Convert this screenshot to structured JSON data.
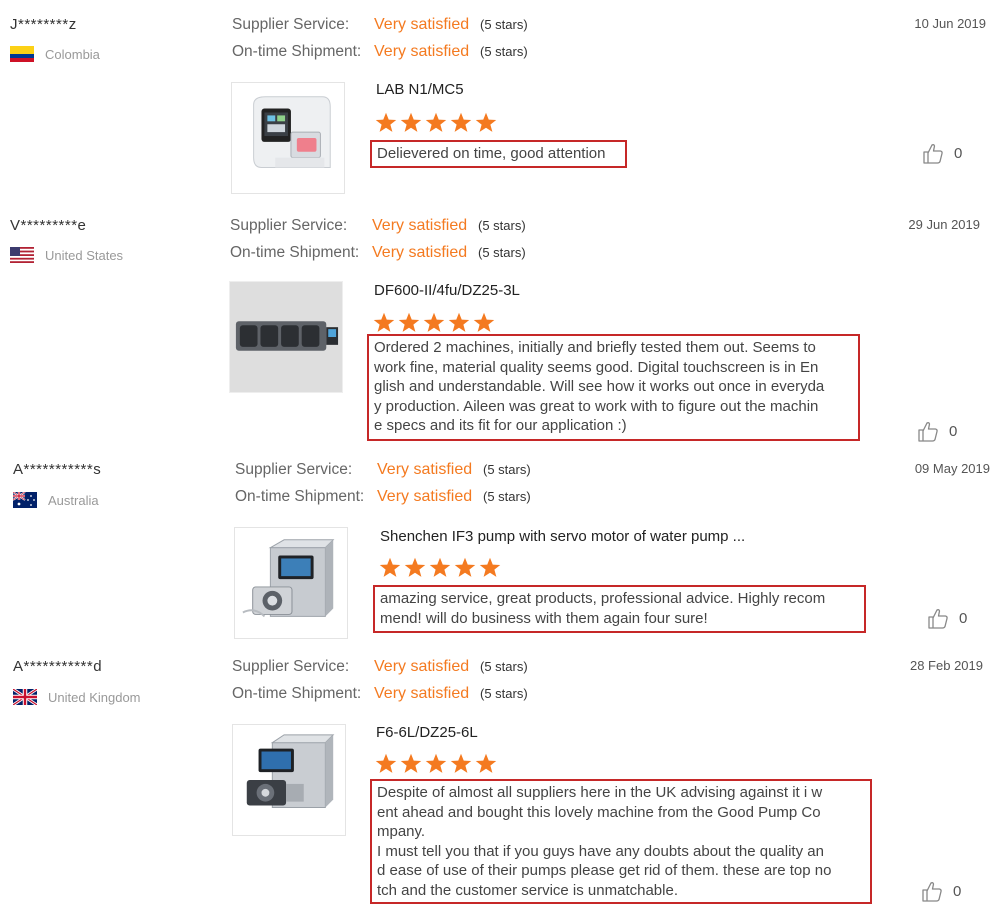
{
  "labels": {
    "supplier_service": "Supplier Service:",
    "ontime_shipment": "On-time Shipment:"
  },
  "colors": {
    "accent_orange": "#f47a20",
    "highlight_red": "#c62828",
    "star_orange": "#f47a20"
  },
  "reviews": [
    {
      "buyer": "J********z",
      "country": "Colombia",
      "flag": "colombia-flag",
      "date": "10 Jun 2019",
      "supplier_service": "Very satisfied",
      "supplier_service_stars": "(5 stars)",
      "shipment": "Very satisfied",
      "shipment_stars": "(5 stars)",
      "product": "LAB N1/MC5",
      "rating": 5,
      "comment": [
        "Delievered on time, good attention"
      ],
      "likes": "0"
    },
    {
      "buyer": "V*********e",
      "country": "United States",
      "flag": "usa-flag",
      "date": "29 Jun 2019",
      "supplier_service": "Very satisfied",
      "supplier_service_stars": "(5 stars)",
      "shipment": "Very satisfied",
      "shipment_stars": "(5 stars)",
      "product": "DF600-II/4fu/DZ25-3L",
      "rating": 5,
      "comment": [
        "Ordered 2 machines, initially and briefly tested them out. Seems to",
        "work fine, material quality seems good. Digital touchscreen is in En",
        "glish and understandable. Will see how it works out once in everyda",
        "y production. Aileen was great to work with to figure out the machin",
        "e specs and its fit for our application :)"
      ],
      "likes": "0"
    },
    {
      "buyer": "A***********s",
      "country": "Australia",
      "flag": "australia-flag",
      "date": "09 May 2019",
      "supplier_service": "Very satisfied",
      "supplier_service_stars": "(5 stars)",
      "shipment": "Very satisfied",
      "shipment_stars": "(5 stars)",
      "product": "Shenchen IF3 pump with servo motor of water pump ...",
      "rating": 5,
      "comment": [
        "amazing service, great products, professional advice. Highly recom",
        "mend! will do business with them again four sure!"
      ],
      "likes": "0"
    },
    {
      "buyer": "A***********d",
      "country": "United Kingdom",
      "flag": "uk-flag",
      "date": "28 Feb 2019",
      "supplier_service": "Very satisfied",
      "supplier_service_stars": "(5 stars)",
      "shipment": "Very satisfied",
      "shipment_stars": "(5 stars)",
      "product": "F6-6L/DZ25-6L",
      "rating": 5,
      "comment": [
        "Despite of almost all suppliers here in the UK advising against it i w",
        "ent ahead and bought this lovely machine from the Good Pump Co",
        "mpany.",
        "I must tell you that if you guys have any doubts about the quality an",
        "d ease of use of their pumps please get rid of them. these are top no",
        "tch and the customer service is unmatchable."
      ],
      "likes": "0"
    }
  ]
}
